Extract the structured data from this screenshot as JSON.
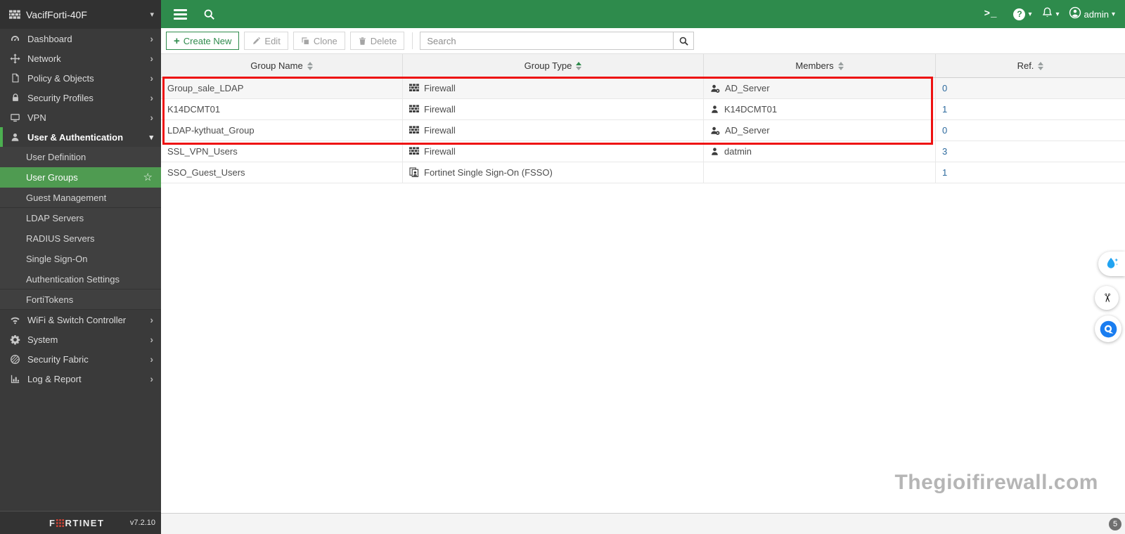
{
  "device": {
    "name": "VacifForti-40F",
    "version": "v7.2.10"
  },
  "brand": {
    "left": "F",
    "right": "RTINET"
  },
  "topbar": {
    "admin_label": "admin"
  },
  "sidebar": {
    "items": [
      {
        "label": "Dashboard",
        "icon": "gauge-icon"
      },
      {
        "label": "Network",
        "icon": "move-icon"
      },
      {
        "label": "Policy & Objects",
        "icon": "document-icon"
      },
      {
        "label": "Security Profiles",
        "icon": "lock-icon"
      },
      {
        "label": "VPN",
        "icon": "monitor-icon"
      },
      {
        "label": "User & Authentication",
        "icon": "user-icon",
        "expanded": true
      },
      {
        "label": "WiFi & Switch Controller",
        "icon": "wifi-icon"
      },
      {
        "label": "System",
        "icon": "gear-icon"
      },
      {
        "label": "Security Fabric",
        "icon": "fabric-icon"
      },
      {
        "label": "Log & Report",
        "icon": "chart-icon"
      }
    ],
    "subitems": [
      {
        "label": "User Definition"
      },
      {
        "label": "User Groups",
        "selected": true
      },
      {
        "label": "Guest Management"
      },
      {
        "label": "LDAP Servers"
      },
      {
        "label": "RADIUS Servers"
      },
      {
        "label": "Single Sign-On"
      },
      {
        "label": "Authentication Settings"
      },
      {
        "label": "FortiTokens"
      }
    ]
  },
  "toolbar": {
    "create_label": "Create New",
    "edit_label": "Edit",
    "clone_label": "Clone",
    "delete_label": "Delete",
    "search_placeholder": "Search"
  },
  "table": {
    "columns": [
      {
        "label": "Group Name"
      },
      {
        "label": "Group Type",
        "sorted": "asc"
      },
      {
        "label": "Members"
      },
      {
        "label": "Ref."
      }
    ],
    "rows": [
      {
        "name": "Group_sale_LDAP",
        "type": "Firewall",
        "type_icon": "firewall-icon",
        "member": "AD_Server",
        "member_icon": "user-server-icon",
        "ref": "0"
      },
      {
        "name": "K14DCMT01",
        "type": "Firewall",
        "type_icon": "firewall-icon",
        "member": "K14DCMT01",
        "member_icon": "user-icon",
        "ref": "1"
      },
      {
        "name": "LDAP-kythuat_Group",
        "type": "Firewall",
        "type_icon": "firewall-icon",
        "member": "AD_Server",
        "member_icon": "user-server-icon",
        "ref": "0"
      },
      {
        "name": "SSL_VPN_Users",
        "type": "Firewall",
        "type_icon": "firewall-icon",
        "member": "datmin",
        "member_icon": "user-icon",
        "ref": "3"
      },
      {
        "name": "SSO_Guest_Users",
        "type": "Fortinet Single Sign-On (FSSO)",
        "type_icon": "fsso-icon",
        "member": "",
        "member_icon": "",
        "ref": "1"
      }
    ]
  },
  "statusbar": {
    "count": "5"
  },
  "watermark": {
    "text": "Thegioifirewall.com"
  },
  "colors": {
    "topbar_green": "#2e8b4c",
    "selected_green": "#4f9b51",
    "accent_green": "#4caf50",
    "link_blue": "#2d6a9e",
    "annotation_red": "#ee1111",
    "logo_red": "#cf4436"
  }
}
